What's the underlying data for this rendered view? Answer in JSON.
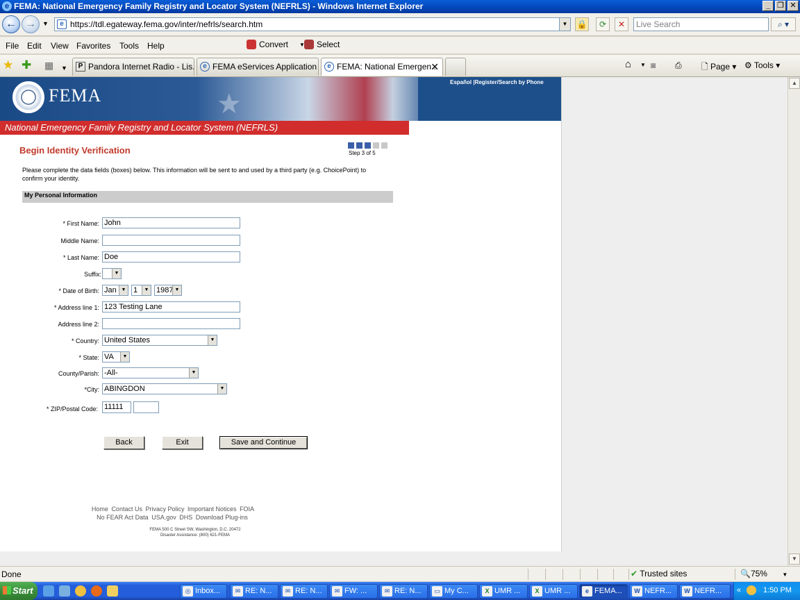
{
  "window": {
    "title": "FEMA: National Emergency Family Registry and Locator System (NEFRLS) - Windows Internet Explorer"
  },
  "browser": {
    "url": "https://tdl.egateway.fema.gov/inter/nefrls/search.htm",
    "search_placeholder": "Live Search",
    "menu": [
      "File",
      "Edit",
      "View",
      "Favorites",
      "Tools",
      "Help"
    ],
    "convert_label": "Convert",
    "select_label": "Select",
    "tabs": [
      {
        "label": "Pandora Internet Radio - Lis..."
      },
      {
        "label": "FEMA eServices Application ..."
      },
      {
        "label": "FEMA: National Emergen..."
      }
    ],
    "page_label": "Page",
    "tools_label": "Tools"
  },
  "page": {
    "header_links": "Español |Register/Search by Phone",
    "logo_text": "FEMA",
    "system_title": "National Emergency Family Registry and Locator System (NEFRLS)",
    "heading": "Begin Identity Verification",
    "step_text": "Step 3 of 5",
    "step_progress": {
      "current": 3,
      "total": 5
    },
    "intro": "Please complete the data fields (boxes) below. This information will be sent to and used by a third party (e.g. ChoicePoint) to confirm your identity.",
    "section_title": "My Personal Information",
    "form": {
      "first_name_label": "* First Name:",
      "first_name": "John",
      "middle_name_label": "Middle Name:",
      "middle_name": "",
      "last_name_label": "* Last Name:",
      "last_name": "Doe",
      "suffix_label": "Suffix:",
      "suffix": "",
      "dob_label": "* Date of Birth:",
      "dob_month": "Jan",
      "dob_day": "1",
      "dob_year": "1987",
      "address1_label": "* Address line 1:",
      "address1": "123 Testing Lane",
      "address2_label": "Address line 2:",
      "address2": "",
      "country_label": "* Country:",
      "country": "United States",
      "state_label": "* State:",
      "state": "VA",
      "county_label": "County/Parish:",
      "county": "-All-",
      "city_label": "*City:",
      "city": "ABINGDON",
      "zip_label": "* ZIP/Postal Code:",
      "zip": "11111",
      "zip_ext": ""
    },
    "buttons": {
      "back": "Back",
      "exit": "Exit",
      "save": "Save and Continue"
    },
    "footer_links_row1": [
      "Home",
      "Contact Us",
      "Privacy Policy",
      "Important Notices",
      "FOIA"
    ],
    "footer_links_row2": [
      "No FEAR Act Data",
      "USA.gov",
      "DHS",
      "Download Plug-ins"
    ],
    "footer_address": "FEMA 500 C Street SW, Washington, D.C. 20472",
    "footer_phone": "Disaster Assistance: (800) 621-FEMA"
  },
  "statusbar": {
    "status": "Done",
    "zone": "Trusted sites",
    "zoom": "75%"
  },
  "taskbar": {
    "start": "Start",
    "tasks": [
      {
        "label": "Inbox...",
        "icon": "outlook-icon"
      },
      {
        "label": "RE: N...",
        "icon": "mail-icon"
      },
      {
        "label": "RE: N...",
        "icon": "mail-icon"
      },
      {
        "label": "FW: ...",
        "icon": "mail-icon"
      },
      {
        "label": "RE: N...",
        "icon": "mail-icon"
      },
      {
        "label": "My C...",
        "icon": "folder-icon"
      },
      {
        "label": "UMR ...",
        "icon": "excel-icon"
      },
      {
        "label": "UMR ...",
        "icon": "excel-icon"
      },
      {
        "label": "FEMA...",
        "icon": "ie-icon"
      },
      {
        "label": "NEFR...",
        "icon": "word-icon"
      },
      {
        "label": "NEFR...",
        "icon": "word-icon"
      }
    ],
    "clock": "1:50 PM"
  }
}
